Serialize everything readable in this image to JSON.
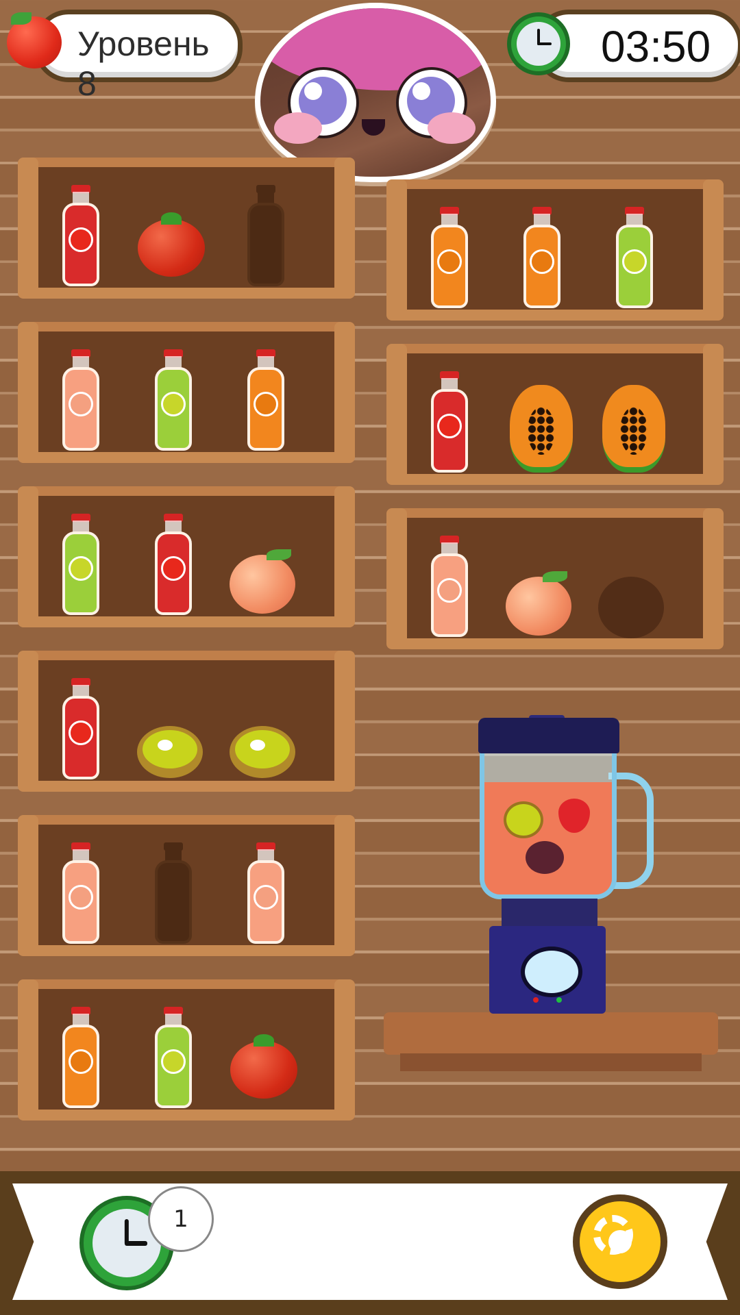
{
  "hud": {
    "level_label": "Уровень 8",
    "timer": "03:50"
  },
  "colors": {
    "tomato_juice": "#d92b2b",
    "kiwi_juice": "#9bcf3a",
    "papaya_juice": "#f2861e",
    "peach_juice": "#f7a080",
    "wood": "#9a6a46",
    "shelf": "#c07f4a",
    "blender": "#2b2780",
    "gear": "#ffc71a"
  },
  "shelves": [
    {
      "name": "shelf-left-1",
      "items": [
        "bottle-tomato",
        "tomato",
        "empty-bottle"
      ]
    },
    {
      "name": "shelf-left-2",
      "items": [
        "bottle-peach",
        "bottle-kiwi",
        "bottle-papaya"
      ]
    },
    {
      "name": "shelf-left-3",
      "items": [
        "bottle-kiwi",
        "bottle-tomato",
        "peach"
      ]
    },
    {
      "name": "shelf-left-4",
      "items": [
        "bottle-tomato",
        "kiwi",
        "kiwi"
      ]
    },
    {
      "name": "shelf-left-5",
      "items": [
        "bottle-peach",
        "empty-bottle",
        "bottle-peach"
      ]
    },
    {
      "name": "shelf-left-6",
      "items": [
        "bottle-papaya",
        "bottle-kiwi",
        "tomato"
      ]
    },
    {
      "name": "shelf-right-1",
      "items": [
        "bottle-papaya",
        "bottle-papaya",
        "bottle-kiwi"
      ]
    },
    {
      "name": "shelf-right-2",
      "items": [
        "bottle-tomato",
        "papaya",
        "papaya"
      ]
    },
    {
      "name": "shelf-right-3",
      "items": [
        "bottle-peach",
        "peach",
        "empty-apple"
      ]
    }
  ],
  "blender": {
    "contents": [
      "kiwi",
      "strawberry",
      "mangosteen"
    ]
  },
  "bottom_bar": {
    "time_bonus_count": "1",
    "time_bonus_icon": "clock-icon",
    "settings_icon": "gear-icon"
  }
}
